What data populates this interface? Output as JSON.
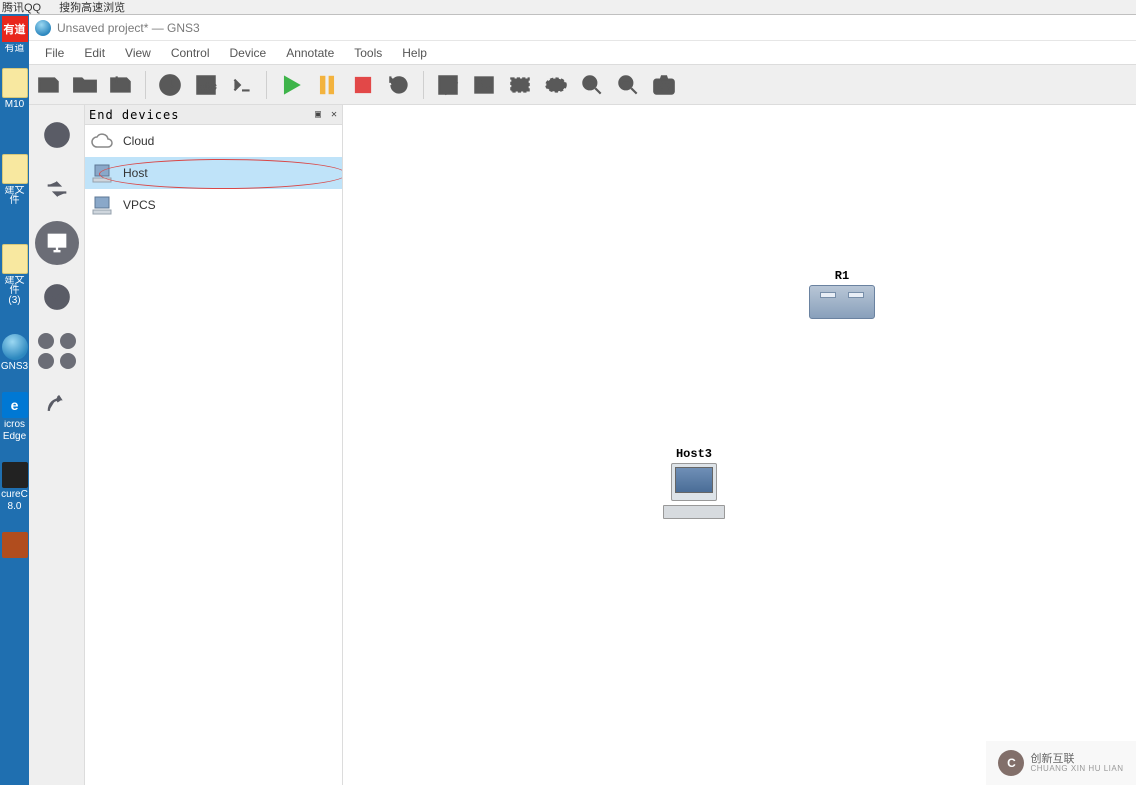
{
  "top_strip": {
    "item1": "腾讯QQ",
    "item2": "搜狗高速浏览"
  },
  "desktop": {
    "youdao": "有道",
    "m10": "M10",
    "newfile": "建文件",
    "newfile3": "建文件\n(3)",
    "edge1": "icros",
    "edge2": "Edge",
    "gns3": "GNS3",
    "securecrt1": "cureC",
    "securecrt2": "8.0"
  },
  "window": {
    "title": "Unsaved project* — GNS3"
  },
  "menu": {
    "file": "File",
    "edit": "Edit",
    "view": "View",
    "control": "Control",
    "device": "Device",
    "annotate": "Annotate",
    "tools": "Tools",
    "help": "Help"
  },
  "dock": {
    "title": "End devices"
  },
  "devices": {
    "cloud": "Cloud",
    "host": "Host",
    "vpcs": "VPCS"
  },
  "canvas": {
    "r1_label": "R1",
    "host3_label": "Host3"
  },
  "watermark": {
    "brand": "创新互联",
    "sub": "CHUANG XIN HU LIAN"
  }
}
